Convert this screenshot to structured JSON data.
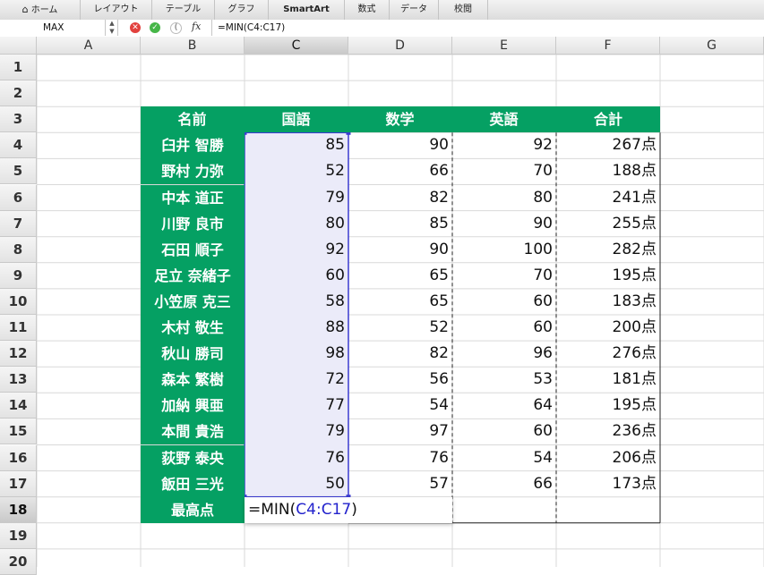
{
  "ribbon": {
    "tabs": [
      {
        "label": "ホーム",
        "icon": "home-icon"
      },
      {
        "label": "レイアウト"
      },
      {
        "label": "テーブル"
      },
      {
        "label": "グラフ"
      },
      {
        "label": "SmartArt"
      },
      {
        "label": "数式"
      },
      {
        "label": "データ"
      },
      {
        "label": "校閲"
      }
    ]
  },
  "formula_bar": {
    "name_box": "MAX",
    "fx": "fx",
    "formula": "=MIN(C4:C17)"
  },
  "columns": [
    "A",
    "B",
    "C",
    "D",
    "E",
    "F",
    "G"
  ],
  "rows": [
    "1",
    "2",
    "3",
    "4",
    "5",
    "6",
    "7",
    "8",
    "9",
    "10",
    "11",
    "12",
    "13",
    "14",
    "15",
    "16",
    "17",
    "18",
    "19",
    "20"
  ],
  "selected": {
    "column": "C",
    "row": "18"
  },
  "table": {
    "headers": [
      "名前",
      "国語",
      "数学",
      "英語",
      "合計"
    ],
    "records": [
      {
        "name": "臼井 智勝",
        "japanese": "85",
        "math": "90",
        "english": "92",
        "total": "267点"
      },
      {
        "name": "野村 力弥",
        "japanese": "52",
        "math": "66",
        "english": "70",
        "total": "188点"
      },
      {
        "name": "中本 道正",
        "japanese": "79",
        "math": "82",
        "english": "80",
        "total": "241点"
      },
      {
        "name": "川野 良市",
        "japanese": "80",
        "math": "85",
        "english": "90",
        "total": "255点"
      },
      {
        "name": "石田 順子",
        "japanese": "92",
        "math": "90",
        "english": "100",
        "total": "282点"
      },
      {
        "name": "足立 奈緒子",
        "japanese": "60",
        "math": "65",
        "english": "70",
        "total": "195点"
      },
      {
        "name": "小笠原 克三",
        "japanese": "58",
        "math": "65",
        "english": "60",
        "total": "183点"
      },
      {
        "name": "木村 敬生",
        "japanese": "88",
        "math": "52",
        "english": "60",
        "total": "200点"
      },
      {
        "name": "秋山 勝司",
        "japanese": "98",
        "math": "82",
        "english": "96",
        "total": "276点"
      },
      {
        "name": "森本 繁樹",
        "japanese": "72",
        "math": "56",
        "english": "53",
        "total": "181点"
      },
      {
        "name": "加納 興亜",
        "japanese": "77",
        "math": "54",
        "english": "64",
        "total": "195点"
      },
      {
        "name": "本間 貴浩",
        "japanese": "79",
        "math": "97",
        "english": "60",
        "total": "236点"
      },
      {
        "name": "荻野 泰央",
        "japanese": "76",
        "math": "76",
        "english": "54",
        "total": "206点"
      },
      {
        "name": "飯田 三光",
        "japanese": "50",
        "math": "57",
        "english": "66",
        "total": "173点"
      }
    ],
    "footer_label": "最高点",
    "edit_prefix": "=MIN(",
    "edit_ref": "C4:C17",
    "edit_suffix": ")"
  },
  "colors": {
    "header_green": "#05a063",
    "range_fill": "#ebebf9",
    "range_border": "#3b3bd0",
    "reference_text": "#2222cc"
  }
}
